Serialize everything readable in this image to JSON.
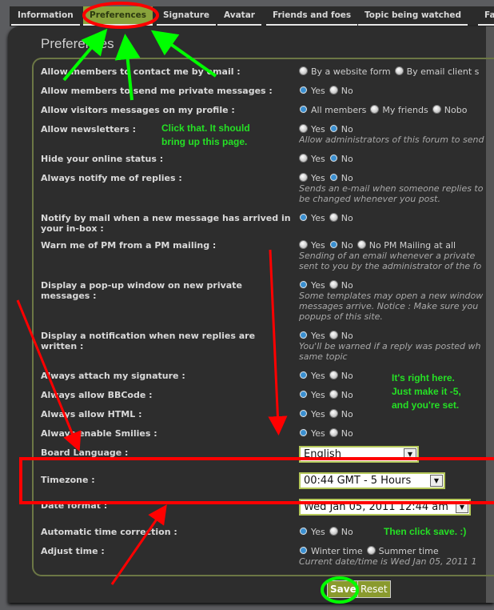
{
  "tabs": [
    {
      "label": "Information"
    },
    {
      "label": "Preferences",
      "active": true
    },
    {
      "label": "Signature"
    },
    {
      "label": "Avatar"
    },
    {
      "label": "Friends and foes"
    },
    {
      "label": "Topic being watched"
    },
    {
      "label": "Fa"
    }
  ],
  "page_title": "Preferences",
  "rows": [
    {
      "label": "Allow members to contact me by email :",
      "options": [
        {
          "label": "By a website form",
          "checked": false
        },
        {
          "label": "By email client s",
          "checked": false
        }
      ]
    },
    {
      "label": "Allow members to send me private messages :",
      "options": [
        {
          "label": "Yes",
          "checked": true
        },
        {
          "label": "No",
          "checked": false
        }
      ]
    },
    {
      "label": "Allow visitors messages on my profile :",
      "options": [
        {
          "label": "All members",
          "checked": true
        },
        {
          "label": "My friends",
          "checked": false
        },
        {
          "label": "Nobo",
          "checked": false
        }
      ]
    },
    {
      "label": "Allow newsletters :",
      "options": [
        {
          "label": "Yes",
          "checked": false
        },
        {
          "label": "No",
          "checked": true
        }
      ],
      "desc": [
        "Allow administrators of this forum to send"
      ]
    },
    {
      "label": "Hide your online status :",
      "options": [
        {
          "label": "Yes",
          "checked": false
        },
        {
          "label": "No",
          "checked": true
        }
      ]
    },
    {
      "label": "Always notify me of replies :",
      "options": [
        {
          "label": "Yes",
          "checked": false
        },
        {
          "label": "No",
          "checked": true
        }
      ],
      "desc": [
        "Sends an e-mail when someone replies to",
        "be changed whenever you post."
      ]
    },
    {
      "label": "Notify by mail when a new message has arrived in your in-box :",
      "options": [
        {
          "label": "Yes",
          "checked": true
        },
        {
          "label": "No",
          "checked": false
        }
      ]
    },
    {
      "label": "Warn me of PM from a PM mailing :",
      "options": [
        {
          "label": "Yes",
          "checked": false
        },
        {
          "label": "No",
          "checked": true
        },
        {
          "label": "No PM Mailing at all",
          "checked": false
        }
      ],
      "desc": [
        "Sending of an email whenever a private",
        "sent to you by the administrator of the fo"
      ]
    },
    {
      "label": "Display a pop-up window on new private messages :",
      "options": [
        {
          "label": "Yes",
          "checked": true
        },
        {
          "label": "No",
          "checked": false
        }
      ],
      "desc": [
        "Some templates may open a new window",
        "messages arrive. Notice : Make sure you",
        "popups of this site."
      ]
    },
    {
      "label": "Display a notification when new replies are written :",
      "options": [
        {
          "label": "Yes",
          "checked": true
        },
        {
          "label": "No",
          "checked": false
        }
      ],
      "desc": [
        "You'll be warned if a reply was posted wh",
        "same topic"
      ]
    },
    {
      "label": "Always attach my signature :",
      "options": [
        {
          "label": "Yes",
          "checked": true
        },
        {
          "label": "No",
          "checked": false
        }
      ]
    },
    {
      "label": "Always allow BBCode :",
      "options": [
        {
          "label": "Yes",
          "checked": true
        },
        {
          "label": "No",
          "checked": false
        }
      ]
    },
    {
      "label": "Always allow HTML :",
      "options": [
        {
          "label": "Yes",
          "checked": true
        },
        {
          "label": "No",
          "checked": false
        }
      ]
    },
    {
      "label": "Always enable Smilies :",
      "options": [
        {
          "label": "Yes",
          "checked": true
        },
        {
          "label": "No",
          "checked": false
        }
      ]
    },
    {
      "label": "Board Language :",
      "select": "English"
    },
    {
      "label": "Timezone :",
      "select": "00:44 GMT - 5 Hours"
    },
    {
      "label": "Date format :",
      "select": "Wed Jan 05, 2011 12:44 am"
    },
    {
      "label": "Automatic time correction :",
      "options": [
        {
          "label": "Yes",
          "checked": true
        },
        {
          "label": "No",
          "checked": false
        }
      ]
    },
    {
      "label": "Adjust time :",
      "options": [
        {
          "label": "Winter time",
          "checked": true
        },
        {
          "label": "Summer time",
          "checked": false
        }
      ],
      "desc": [
        "Current date/time is Wed Jan 05, 2011 1"
      ]
    }
  ],
  "buttons": {
    "save": "Save",
    "reset": "Reset"
  },
  "annotations": {
    "note1": [
      "Click that.  It should",
      "bring up this page."
    ],
    "note2": [
      "It's right here.",
      "Just make it -5,",
      "and you're set."
    ],
    "note3": [
      "Then click save. :)"
    ],
    "colors": {
      "arrow_green": "#00ff00",
      "highlight_red": "#ff0000"
    }
  }
}
